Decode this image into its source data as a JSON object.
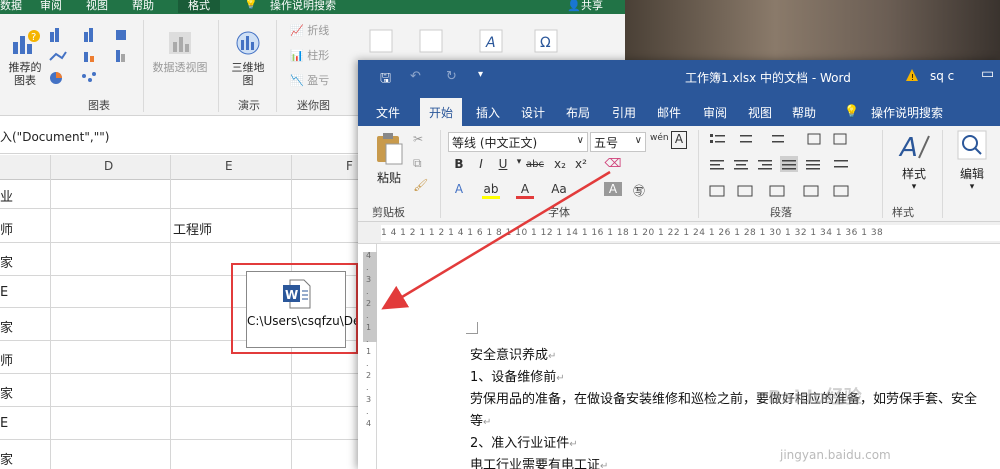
{
  "excel": {
    "tabs": [
      "数据",
      "审阅",
      "视图",
      "帮助",
      "格式",
      "操作说明搜索"
    ],
    "share": "共享",
    "ribbon": {
      "recommended_charts": "推荐的\n图表",
      "pivot_chart": "数据透视图",
      "map3d": "三维地\n图",
      "sparkline_line": "折线",
      "sparkline_column": "柱形",
      "sparkline_winloss": "盈亏",
      "group_charts": "图表",
      "group_tours": "演示",
      "group_sparklines": "迷你图"
    },
    "formula_text": "入(\"Document\",\"\")",
    "columns": [
      "D",
      "E",
      "F"
    ],
    "rows_col_a": [
      "业",
      "师",
      "家",
      "E",
      "家",
      "师",
      "家",
      "E",
      "家"
    ],
    "cell_e": "工程师",
    "embedded_object_text": "C:\\Users\\csqfzu\\Desktop\\"
  },
  "word": {
    "title": "工作簿1.xlsx 中的文档 - Word",
    "user": "sq c",
    "tabs": [
      "文件",
      "开始",
      "插入",
      "设计",
      "布局",
      "引用",
      "邮件",
      "审阅",
      "视图",
      "帮助",
      "操作说明搜索"
    ],
    "ribbon": {
      "paste": "粘贴",
      "font_name": "等线 (中文正文)",
      "font_size": "五号",
      "styles": "样式",
      "editing": "编辑",
      "group_clipboard": "剪贴板",
      "group_font": "字体",
      "group_paragraph": "段落",
      "group_styles": "样式"
    },
    "ruler": "1 4 1 2 1  1 2 1 4 1 6 1 8 1 10 1 12 1 14 1 16 1 18 1 20 1 22 1 24 1 26 1 28 1 30 1 32 1 34 1 36 1 38",
    "vruler": "4 . 3 . 2 . 1 . 1 . 2 . 3 . 4",
    "doc_lines": [
      "安全意识养成",
      "1、设备维修前",
      "劳保用品的准备，在做设备安装维修和巡检之前，要做好相应的准备，如劳保手套、安全",
      "等",
      "2、准入行业证件",
      "电工行业需要有电工证"
    ]
  },
  "watermark": "Baidu经验",
  "watermark_url": "jingyan.baidu.com",
  "colors": {
    "excel_green": "#217346",
    "word_blue": "#2b579a",
    "highlight_red": "#e23b3b"
  }
}
